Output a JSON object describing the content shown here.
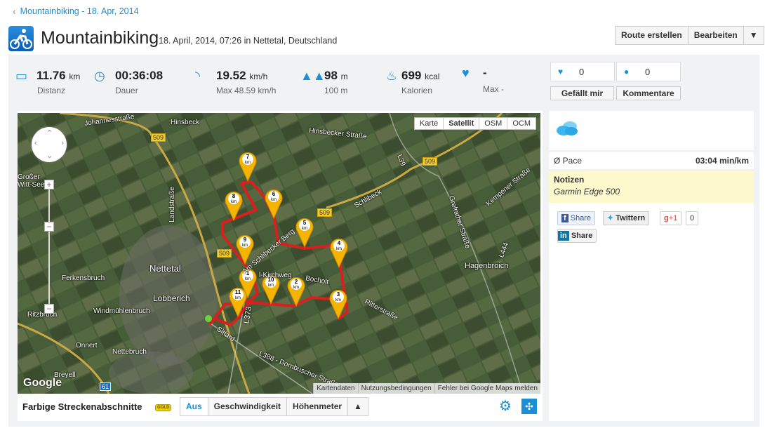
{
  "breadcrumb": {
    "label": "Mountainbiking - 18. Apr, 2014"
  },
  "header": {
    "title": "Mountainbiking",
    "subtitle": "18. April, 2014, 07:26 in Nettetal, Deutschland",
    "buttons": {
      "route": "Route erstellen",
      "edit": "Bearbeiten",
      "more": "▼"
    }
  },
  "stats": [
    {
      "icon": "ruler-icon",
      "value": "11.76",
      "unit": "km",
      "label": "Distanz"
    },
    {
      "icon": "clock-icon",
      "value": "00:36:08",
      "unit": "",
      "label": "Dauer"
    },
    {
      "icon": "speedometer-icon",
      "value": "19.52",
      "unit": "km/h",
      "label": "Max 48.59 km/h"
    },
    {
      "icon": "mountains-icon",
      "value": "98",
      "unit": "m",
      "label": "100 m"
    },
    {
      "icon": "flame-icon",
      "value": "699",
      "unit": "kcal",
      "label": "Kalorien"
    },
    {
      "icon": "heartbeat-icon",
      "value": "-",
      "unit": "",
      "label": "Max -"
    }
  ],
  "social": {
    "likes": "0",
    "comments": "0",
    "like_label": "Gefällt mir",
    "comment_label": "Kommentare"
  },
  "map": {
    "types": [
      "Karte",
      "Satellit",
      "OSM",
      "OCM"
    ],
    "active_type": "Satellit",
    "labels": {
      "johannes": "Johannesstraße",
      "hinsbeck": "Hinsbeck",
      "hinsbecker": "Hinsbecker Straße",
      "grosser": "Großer Witt-See",
      "landstr": "Landstraße",
      "schlibeck": "Schlibeck",
      "schlibecker": "Am Schlibecker Berg",
      "nettetal": "Nettetal",
      "ferkensbruch": "Ferkensbruch",
      "lobberich": "Lobberich",
      "windmuehl": "Windmühlenbruch",
      "ritzbruch": "Ritzbruch",
      "kirchweg": "l-Kirchweg",
      "bocholt": "Bocholt",
      "ritterstr": "Ritterstraße",
      "hagenbroich": "Hagenbroich",
      "grefrather": "Grefrather Straße",
      "kempener": "Kempener Straße",
      "sittard": "Sittard",
      "onnert": "Onnert",
      "nettebruch": "Nettebruch",
      "breyell": "Breyell",
      "dornbuscher": "L388 - Dornbuscher Straße",
      "l39": "L39",
      "l444": "L444",
      "l373": "L373",
      "b509": "509",
      "a61": "61"
    },
    "markers": [
      "1",
      "2",
      "3",
      "4",
      "5",
      "6",
      "7",
      "8",
      "9",
      "10",
      "11"
    ],
    "marker_unit": "km",
    "attribution": [
      "Kartendaten",
      "Nutzungsbedingungen",
      "Fehler bei Google Maps melden"
    ],
    "logo": "Google",
    "route_color": "#d9201f"
  },
  "footer": {
    "title": "Farbige Streckenabschnitte",
    "badge": "GOLD",
    "segments": [
      "Aus",
      "Geschwindigkeit",
      "Höhenmeter",
      "▲"
    ],
    "active": "Aus"
  },
  "sidebar": {
    "weather_icon": "cloud-icon",
    "pace_label": "Ø Pace",
    "pace_value": "03:04 min/km",
    "notes_title": "Notizen",
    "notes_text": "Garmin Edge 500",
    "share": {
      "facebook": "Share",
      "twitter": "Twittern",
      "gplus": "+1",
      "gplus_count": "0",
      "linkedin": "Share"
    }
  },
  "colors": {
    "accent": "#1a8fd6",
    "notes_bg": "#fdf9cc"
  }
}
